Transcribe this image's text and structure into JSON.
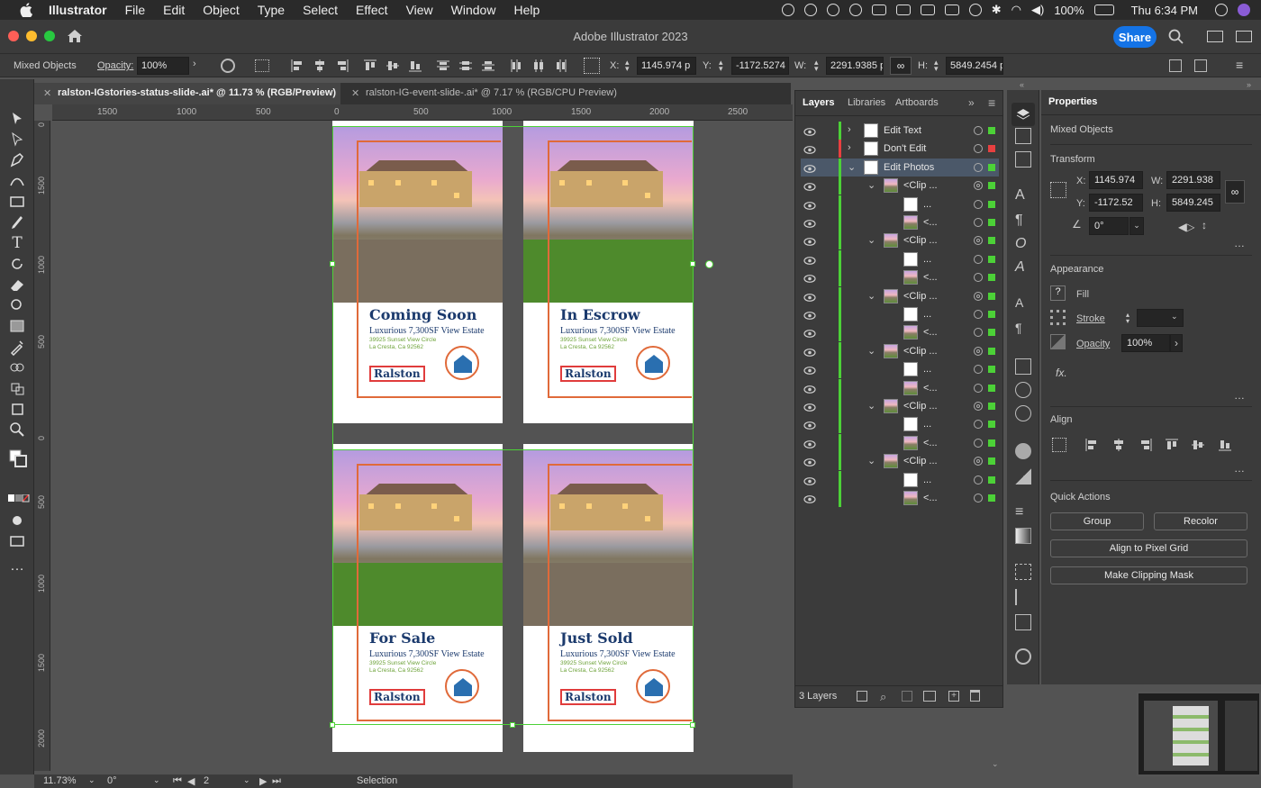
{
  "menubar": {
    "app": "Illustrator",
    "items": [
      "File",
      "Edit",
      "Object",
      "Type",
      "Select",
      "Effect",
      "View",
      "Window",
      "Help"
    ],
    "battery": "100%",
    "clock": "Thu 6:34 PM"
  },
  "window": {
    "title": "Adobe Illustrator 2023",
    "share_label": "Share"
  },
  "control": {
    "selection": "Mixed Objects",
    "opacity_label": "Opacity:",
    "opacity": "100%",
    "x_label": "X:",
    "x": "1145.974 p",
    "y_label": "Y:",
    "y": "-1172.5274",
    "w_label": "W:",
    "w": "2291.9385 p",
    "h_label": "H:",
    "h": "5849.2454 p"
  },
  "tabs": [
    {
      "label": "ralston-IGstories-status-slide-.ai* @ 11.73 % (RGB/Preview)"
    },
    {
      "label": "ralston-IG-event-slide-.ai* @ 7.17 % (RGB/CPU Preview)"
    }
  ],
  "ruler": {
    "top": [
      "1500",
      "1000",
      "500",
      "0",
      "500",
      "1000",
      "1500",
      "2000",
      "2500"
    ],
    "left": [
      "0",
      "1500",
      "1000",
      "500",
      "0",
      "500",
      "1000",
      "1500",
      "2000"
    ]
  },
  "artboards": [
    {
      "headline": "Coming Soon",
      "subtitle": "Luxurious 7,300SF View Estate",
      "address1": "39925 Sunset View Circle",
      "address2": "La Cresta, Ca 92562",
      "brand": "Ralston"
    },
    {
      "headline": "In Escrow",
      "subtitle": "Luxurious 7,300SF View Estate",
      "address1": "39925 Sunset View Circle",
      "address2": "La Cresta, Ca 92562",
      "brand": "Ralston"
    },
    {
      "headline": "For Sale",
      "subtitle": "Luxurious 7,300SF View Estate",
      "address1": "39925 Sunset View Circle",
      "address2": "La Cresta, Ca 92562",
      "brand": "Ralston"
    },
    {
      "headline": "Just Sold",
      "subtitle": "Luxurious 7,300SF View Estate",
      "address1": "39925 Sunset View Circle",
      "address2": "La Cresta, Ca 92562",
      "brand": "Ralston"
    }
  ],
  "layers_panel": {
    "tabs": [
      "Layers",
      "Libraries",
      "Artboards"
    ],
    "rows": [
      {
        "name": "Edit Text",
        "color": "#4cd137",
        "square": "#4cd137"
      },
      {
        "name": "Don't Edit",
        "color": "#e84040",
        "square": "#e84040"
      },
      {
        "name": "Edit Photos",
        "color": "#4cd137",
        "square": "#4cd137"
      },
      {
        "name": "<Clip ..."
      },
      {
        "name": "..."
      },
      {
        "name": "<..."
      },
      {
        "name": "<Clip ..."
      },
      {
        "name": "..."
      },
      {
        "name": "<..."
      },
      {
        "name": "<Clip ..."
      },
      {
        "name": "..."
      },
      {
        "name": "<..."
      },
      {
        "name": "<Clip ..."
      },
      {
        "name": "..."
      },
      {
        "name": "<..."
      },
      {
        "name": "<Clip ..."
      },
      {
        "name": "..."
      },
      {
        "name": "<..."
      },
      {
        "name": "<Clip ..."
      },
      {
        "name": "..."
      },
      {
        "name": "<..."
      }
    ],
    "footer": "3 Layers"
  },
  "properties": {
    "title": "Properties",
    "selection": "Mixed Objects",
    "transform_title": "Transform",
    "x_label": "X:",
    "x": "1145.974",
    "y_label": "Y:",
    "y": "-1172.52",
    "w_label": "W:",
    "w": "2291.938",
    "h_label": "H:",
    "h": "5849.245",
    "angle": "0°",
    "appearance_title": "Appearance",
    "fill_label": "Fill",
    "stroke_label": "Stroke",
    "opacity_label": "Opacity",
    "opacity": "100%",
    "fx_label": "fx.",
    "align_title": "Align",
    "quick_title": "Quick Actions",
    "group": "Group",
    "recolor": "Recolor",
    "align_pixel": "Align to Pixel Grid",
    "clip_mask": "Make Clipping Mask"
  },
  "status": {
    "zoom": "11.73%",
    "angle": "0°",
    "page": "2",
    "tool": "Selection"
  },
  "colors": {
    "accent": "#1473e6",
    "selection_green": "#4cd137",
    "headline": "#1b3a6d",
    "frame_orange": "#e06a3a"
  }
}
